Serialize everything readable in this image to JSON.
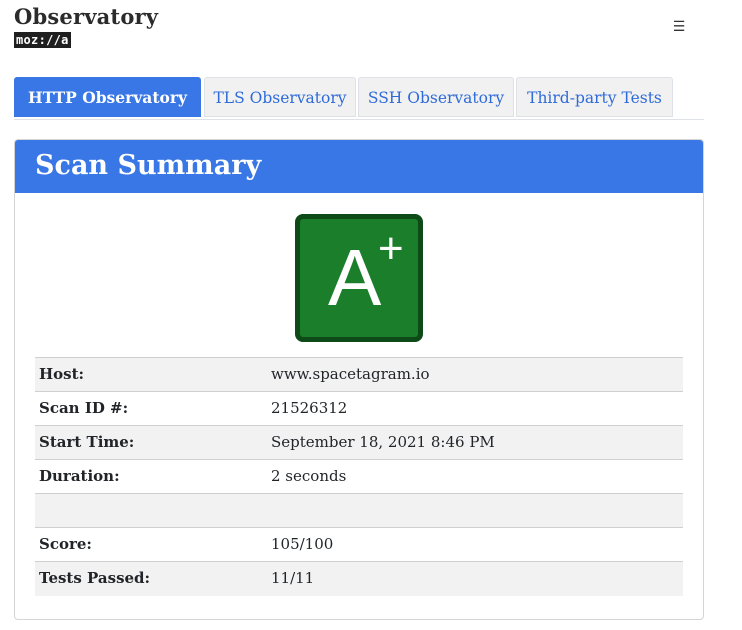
{
  "brand": {
    "title": "Observatory",
    "logo_text": "moz://a"
  },
  "header": {
    "menu_icon": "hamburger-icon",
    "menu_glyph": "☰"
  },
  "tabs": [
    {
      "label": "HTTP Observatory",
      "active": true
    },
    {
      "label": "TLS Observatory",
      "active": false
    },
    {
      "label": "SSH Observatory",
      "active": false
    },
    {
      "label": "Third-party Tests",
      "active": false
    }
  ],
  "summary": {
    "title": "Scan Summary",
    "grade": {
      "letter": "A",
      "modifier": "+",
      "color": "#1b7e2a",
      "border_color": "#0d4a17"
    },
    "rows": [
      {
        "label": "Host:",
        "value": "www.spacetagram.io"
      },
      {
        "label": "Scan ID #:",
        "value": "21526312"
      },
      {
        "label": "Start Time:",
        "value": "September 18, 2021 8:46 PM"
      },
      {
        "label": "Duration:",
        "value": "2 seconds"
      },
      {
        "label": "",
        "value": ""
      },
      {
        "label": "Score:",
        "value": "105/100"
      },
      {
        "label": "Tests Passed:",
        "value": "11/11"
      }
    ]
  },
  "colors": {
    "accent": "#3877e5",
    "tab_text": "#2e6bd8"
  }
}
